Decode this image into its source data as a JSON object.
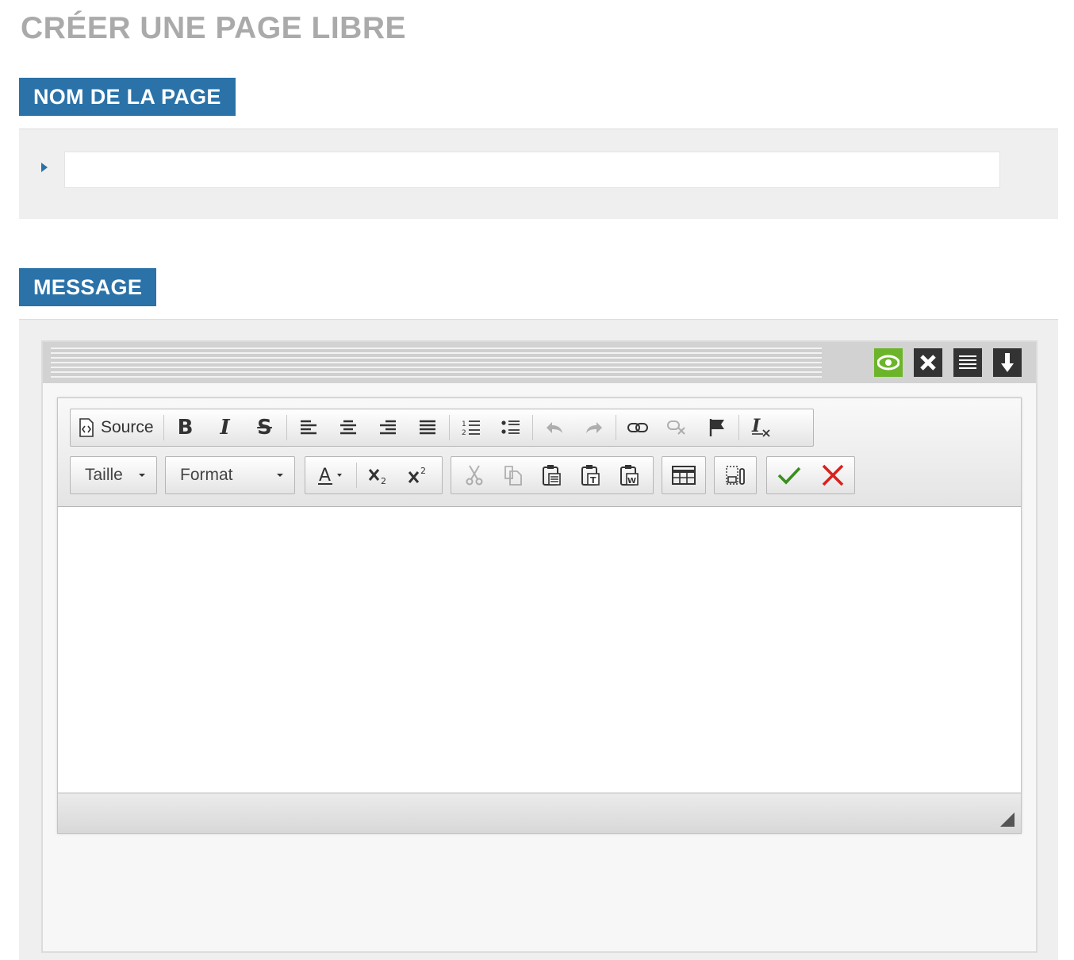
{
  "page": {
    "title": "CRÉER UNE PAGE LIBRE"
  },
  "name_section": {
    "label": "NOM DE LA PAGE",
    "input_value": "",
    "input_placeholder": ""
  },
  "message_section": {
    "label": "MESSAGE"
  },
  "frame_header": {
    "buttons": [
      {
        "icon": "eye-icon",
        "color": "#6cb52b"
      },
      {
        "icon": "close-icon",
        "color": "#333333"
      },
      {
        "icon": "align-justify-icon",
        "color": "#333333"
      },
      {
        "icon": "arrow-down-icon",
        "color": "#333333"
      }
    ]
  },
  "editor": {
    "toolbar_row1": {
      "source_label": "Source",
      "buttons": [
        "source-icon",
        "bold-icon",
        "italic-icon",
        "strikethrough-icon",
        "align-left-icon",
        "align-center-icon",
        "align-right-icon",
        "align-justify-icon",
        "numbered-list-icon",
        "bulleted-list-icon",
        "undo-icon",
        "redo-icon",
        "link-icon",
        "unlink-icon",
        "anchor-flag-icon",
        "remove-format-icon"
      ],
      "disabled": [
        "undo-icon",
        "redo-icon",
        "unlink-icon"
      ]
    },
    "toolbar_row2": {
      "size_label": "Taille",
      "format_label": "Format",
      "buttons": [
        "text-color-icon",
        "subscript-icon",
        "superscript-icon",
        "cut-icon",
        "copy-icon",
        "paste-icon",
        "paste-text-icon",
        "paste-word-icon",
        "table-icon",
        "show-blocks-icon",
        "save-check-icon",
        "cancel-x-icon"
      ],
      "disabled": [
        "cut-icon",
        "copy-icon"
      ]
    },
    "content": ""
  }
}
